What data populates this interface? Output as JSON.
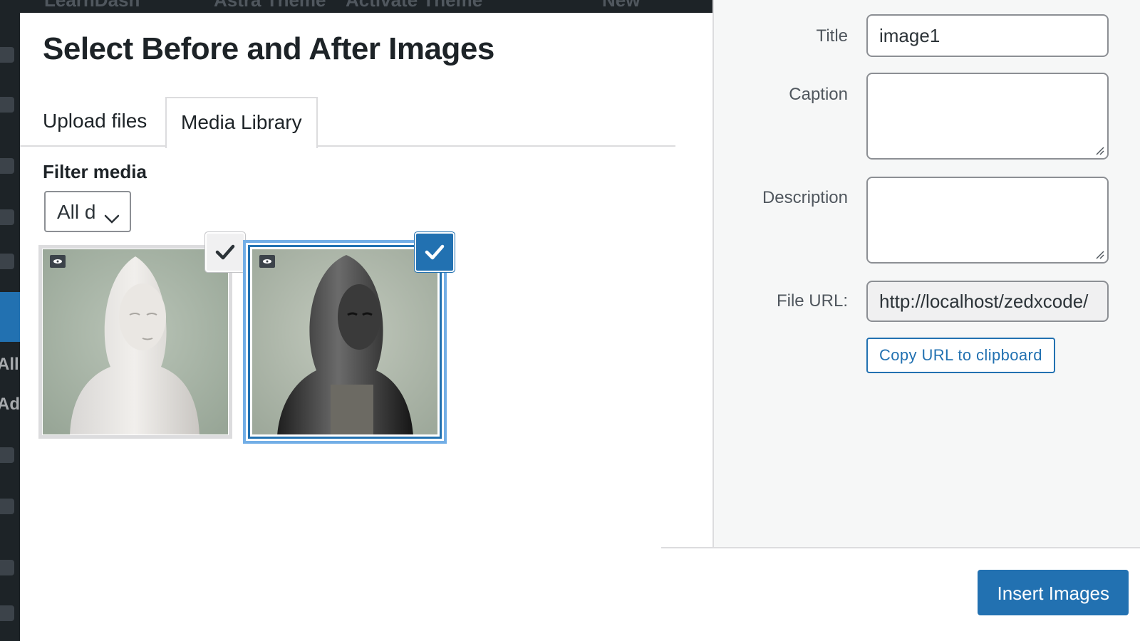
{
  "admin_bar": {
    "items": [
      "LearnDash",
      "Astra Theme",
      "Activate Theme",
      "New"
    ]
  },
  "admin_sidebar": {
    "labels": [
      "All",
      "Ad"
    ]
  },
  "modal": {
    "title": "Select Before and After Images",
    "tabs": [
      {
        "label": "Upload files",
        "active": false
      },
      {
        "label": "Media Library",
        "active": true
      }
    ],
    "filter": {
      "label": "Filter media",
      "selected": "All d"
    },
    "attachments": [
      {
        "name": "marble statue bust",
        "selected": true,
        "focused": false
      },
      {
        "name": "dark statue bust",
        "selected": true,
        "focused": true
      }
    ]
  },
  "details": {
    "title": {
      "label": "Title",
      "value": "image1"
    },
    "caption": {
      "label": "Caption",
      "value": ""
    },
    "description": {
      "label": "Description",
      "value": ""
    },
    "file_url": {
      "label": "File URL:",
      "value": "http://localhost/zedxcode/"
    },
    "copy_button": "Copy URL to clipboard"
  },
  "toolbar": {
    "insert_button": "Insert Images"
  },
  "colors": {
    "accent": "#2271b1",
    "focus": "#72aee6",
    "admin_dark": "#1d2327"
  }
}
